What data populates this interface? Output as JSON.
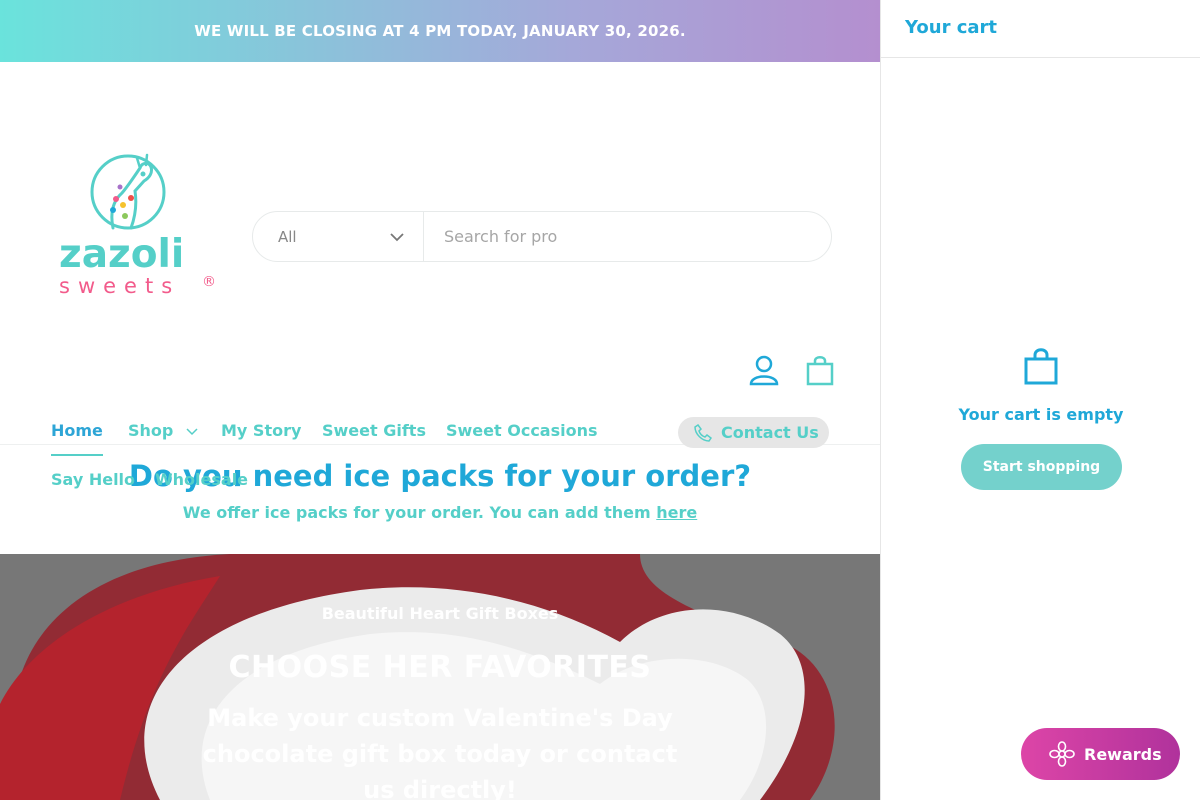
{
  "announcement": "WE WILL BE CLOSING AT 4 PM TODAY, JANUARY 30, 2026.",
  "brand": {
    "line1": "zazoli",
    "line2": "sweets",
    "trademark": "®"
  },
  "search": {
    "category": "All",
    "placeholder": "Search for pro"
  },
  "nav": {
    "items": [
      "Home",
      "Shop",
      "My Story",
      "Sweet Gifts",
      "Sweet Occasions",
      "Say Hello",
      "Wholesale"
    ],
    "contact": "Contact Us"
  },
  "ice_packs": {
    "heading": "Do you need ice packs for your order?",
    "text": "We offer ice packs for your order. You can add them",
    "link": "here"
  },
  "hero": {
    "subheading": "Beautiful Heart Gift Boxes",
    "heading": "CHOOSE HER FAVORITES",
    "body": "Make your custom Valentine's Day chocolate gift box today or contact us directly!"
  },
  "cart": {
    "title": "Your cart",
    "empty_message": "Your cart is empty",
    "button": "Start shopping"
  },
  "rewards": "Rewards",
  "colors": {
    "teal": "#55cfc8",
    "blue": "#1fa8d8",
    "heart_red": "#c01f2a",
    "rewards_pink": "#d3419f"
  },
  "icons": [
    "giraffe-logo-icon",
    "chevron-down-icon",
    "account-icon",
    "bag-icon",
    "phone-icon",
    "flower-icon"
  ]
}
